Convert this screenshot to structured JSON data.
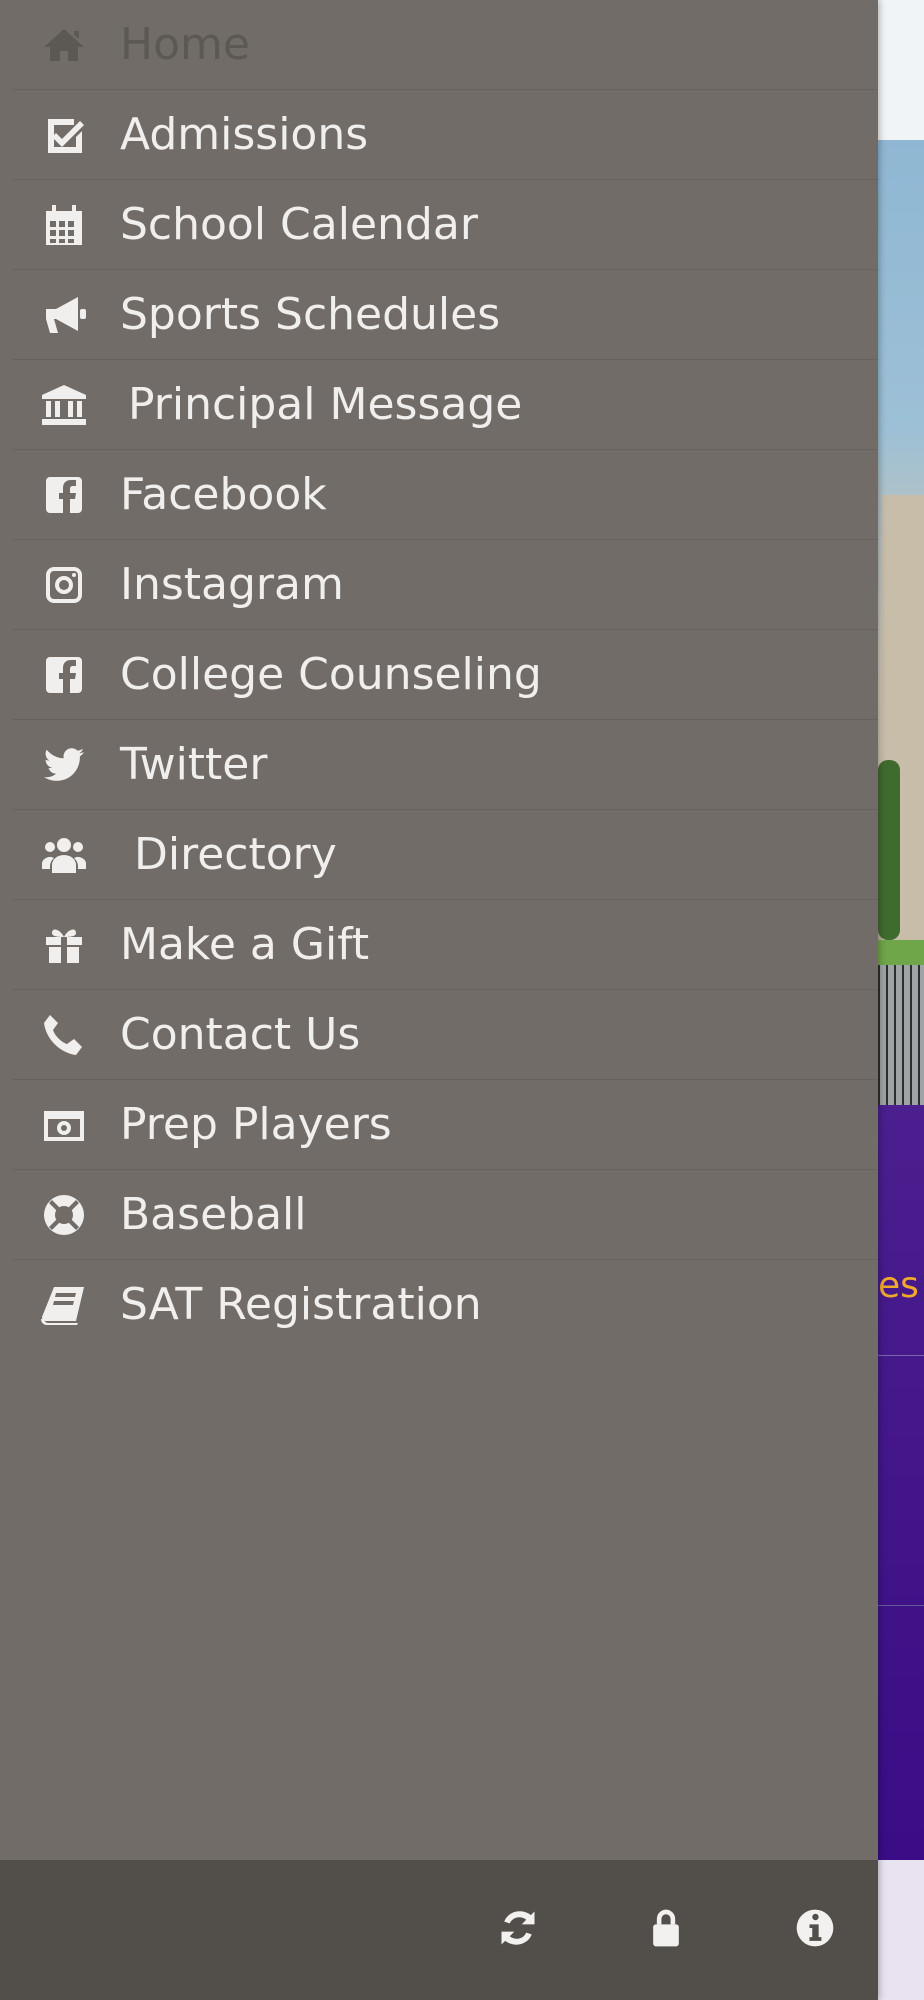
{
  "menu": {
    "items": [
      {
        "label": "Home",
        "icon": "home-icon"
      },
      {
        "label": "Admissions",
        "icon": "check-square-icon"
      },
      {
        "label": "School Calendar",
        "icon": "calendar-icon"
      },
      {
        "label": "Sports Schedules",
        "icon": "megaphone-icon"
      },
      {
        "label": "Principal Message",
        "icon": "institution-icon"
      },
      {
        "label": "Facebook",
        "icon": "facebook-icon"
      },
      {
        "label": "Instagram",
        "icon": "instagram-icon"
      },
      {
        "label": "College Counseling",
        "icon": "facebook-icon"
      },
      {
        "label": "Twitter",
        "icon": "twitter-icon"
      },
      {
        "label": "Directory",
        "icon": "users-icon"
      },
      {
        "label": "Make a Gift",
        "icon": "gift-icon"
      },
      {
        "label": "Contact Us",
        "icon": "phone-icon"
      },
      {
        "label": "Prep Players",
        "icon": "camera-icon"
      },
      {
        "label": "Baseball",
        "icon": "life-ring-icon"
      },
      {
        "label": "SAT Registration",
        "icon": "book-icon"
      }
    ]
  },
  "footer": {
    "buttons": [
      "refresh-icon",
      "lock-icon",
      "info-icon"
    ]
  },
  "background": {
    "partial_text": "es"
  },
  "colors": {
    "drawer": "#716c67",
    "footer": "#524f4b",
    "text": "#f1efed",
    "accent_purple": "#3a0c86",
    "accent_orange": "#f1a92b"
  }
}
